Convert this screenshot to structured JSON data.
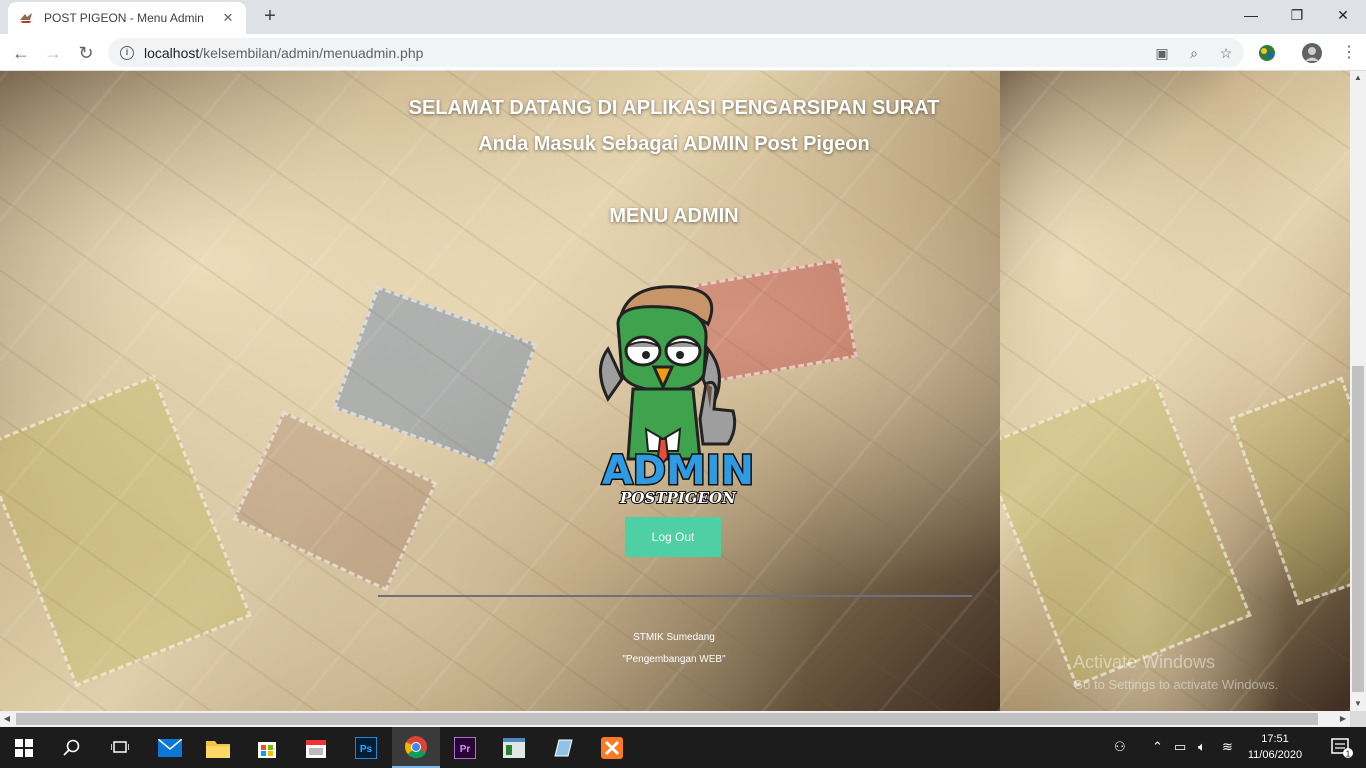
{
  "browser": {
    "tab_title": "POST PIGEON - Menu Admin",
    "new_tab": "+",
    "url_host": "localhost",
    "url_path": "/kelsembilan/admin/menuadmin.php"
  },
  "page": {
    "welcome": "SELAMAT DATANG DI APLIKASI PENGARSIPAN SURAT",
    "role": "Anda Masuk Sebagai ADMIN Post Pigeon",
    "menu_title": "MENU ADMIN",
    "logo_main": "ADMIN",
    "logo_sub": "POSTPIGEON",
    "logout_label": "Log Out",
    "footer_line1": "STMIK Sumedang",
    "footer_line2": "\"Pengembangan WEB\""
  },
  "watermark": {
    "line1": "Activate Windows",
    "line2": "Go to Settings to activate Windows."
  },
  "taskbar": {
    "time": "17:51",
    "date": "11/06/2020",
    "notification_count": "1"
  },
  "colors": {
    "accent_button": "#4fd0a4",
    "chrome_bg": "#dee1e6",
    "taskbar_bg": "#1c1c1c"
  }
}
